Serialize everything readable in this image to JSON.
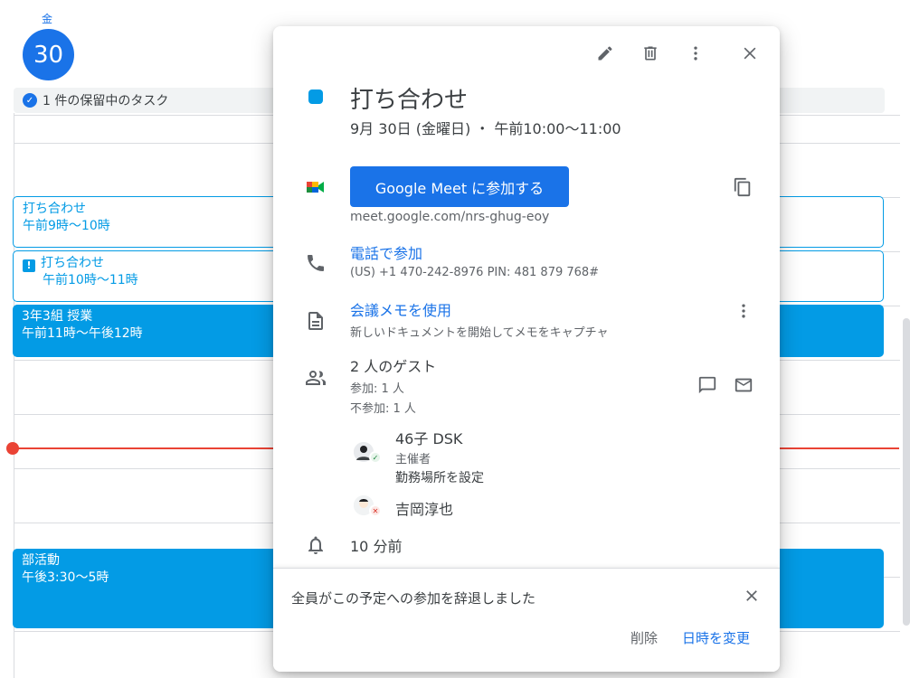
{
  "calendar": {
    "day_of_week": "金",
    "day_number": "30",
    "tasks_label": "1 件の保留中のタスク",
    "events": [
      {
        "title": "打ち合わせ",
        "time": "午前9時～10時"
      },
      {
        "title": "打ち合わせ",
        "time": "午前10時～11時"
      },
      {
        "title": "3年3組 授業",
        "time": "午前11時～午後12時"
      },
      {
        "title": "部活動",
        "time": "午後3:30～5時"
      }
    ]
  },
  "popup": {
    "toolbar": {
      "edit_icon": "pencil-icon",
      "delete_icon": "trash-icon",
      "more_icon": "more-vert-icon",
      "close_icon": "close-icon"
    },
    "event_color": "#039be5",
    "title": "打ち合わせ",
    "datetime": "9月 30日 (金曜日) ・ 午前10:00～11:00",
    "meet": {
      "button_label": "Google Meet に参加する",
      "url": "meet.google.com/nrs-ghug-eoy"
    },
    "phone": {
      "label": "電話で参加",
      "details": "(US) +1 470-242-8976 PIN: 481 879 768#"
    },
    "notes": {
      "label": "会議メモを使用",
      "description": "新しいドキュメントを開始してメモをキャプチャ"
    },
    "guests": {
      "summary": "2 人のゲスト",
      "yes_count": "参加: 1 人",
      "no_count": "不参加: 1 人",
      "list": [
        {
          "name": "46子 DSK",
          "role": "主催者",
          "action": "勤務場所を設定",
          "status": "yes"
        },
        {
          "name": "吉岡淳也",
          "status": "no"
        }
      ]
    },
    "reminder": "10 分前",
    "footer": {
      "message": "全員がこの予定への参加を辞退しました",
      "delete_label": "削除",
      "reschedule_label": "日時を変更"
    }
  },
  "colors": {
    "primary": "#1a73e8",
    "event": "#039be5",
    "now_line": "#ea4335"
  }
}
